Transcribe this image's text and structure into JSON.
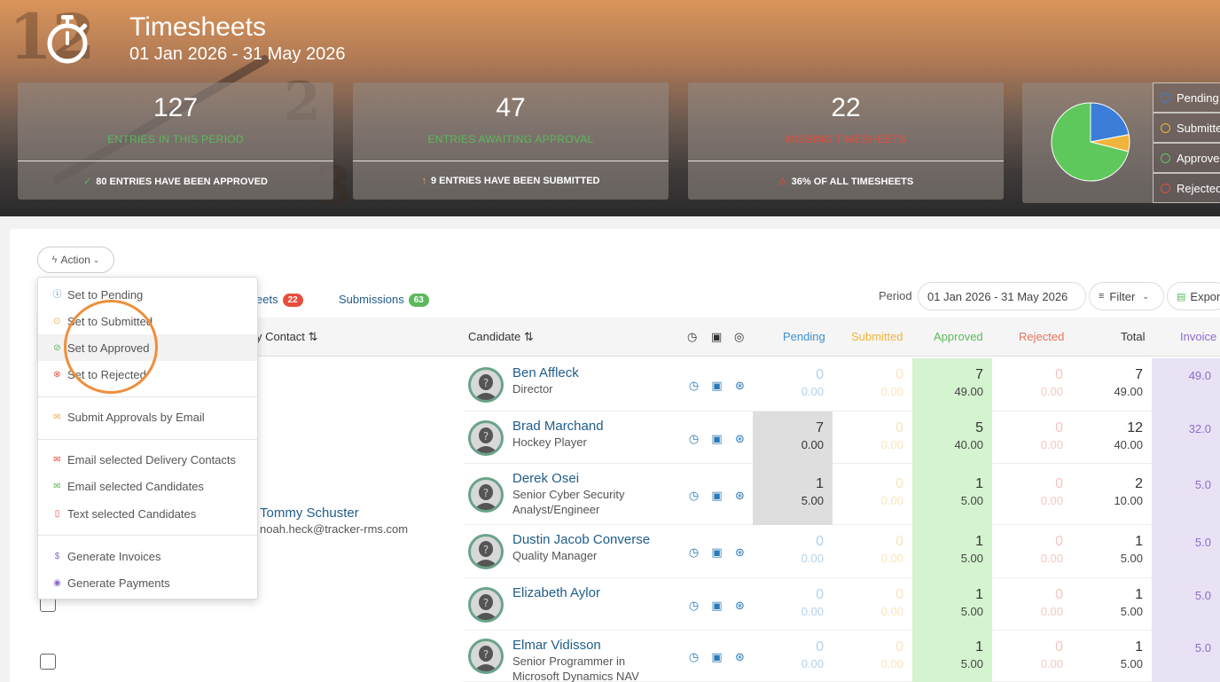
{
  "header": {
    "title": "Timesheets",
    "period": "01 Jan 2026 - 31 May 2026"
  },
  "stats": [
    {
      "value": "127",
      "label": "ENTRIES IN THIS PERIOD",
      "sub": "80 ENTRIES HAVE BEEN APPROVED",
      "sub_icon": "✓",
      "label_color": "#5cb85c",
      "icon_color": "#5cb85c"
    },
    {
      "value": "47",
      "label": "ENTRIES AWAITING APPROVAL",
      "sub": "9 ENTRIES HAVE BEEN SUBMITTED",
      "sub_icon": "↑",
      "label_color": "#5cb85c",
      "icon_color": "#f0ad4e"
    },
    {
      "value": "22",
      "label": "MISSING TIMESHEETS",
      "sub": "36% OF ALL TIMESHEETS",
      "sub_icon": "⚠",
      "label_color": "#e84c3d",
      "icon_color": "#e84c3d"
    }
  ],
  "pie": {
    "slices": [
      {
        "name": "Pending",
        "value": 22,
        "color": "#3b7dd8"
      },
      {
        "name": "Submitted",
        "value": 7,
        "color": "#f0b43c"
      },
      {
        "name": "Approved",
        "value": 71,
        "color": "#5ec85c"
      },
      {
        "name": "Rejected",
        "value": 0,
        "color": "#e84c3d"
      }
    ]
  },
  "legend": [
    {
      "label": "Pending",
      "color": "#3b7dd8"
    },
    {
      "label": "Submitted",
      "color": "#f0b43c"
    },
    {
      "label": "Approved",
      "color": "#5ec85c"
    },
    {
      "label": "Rejected",
      "color": "#e84c3d"
    }
  ],
  "toolbar": {
    "action_label": "Action",
    "tab_timesheets_label": "eets",
    "tab_timesheets_count": "22",
    "tab_submissions_label": "Submissions",
    "tab_submissions_count": "63",
    "period_label": "Period",
    "period_value": "01 Jan 2026 - 31 May 2026",
    "filter_label": "Filter",
    "export_label": "Expor"
  },
  "action_menu": {
    "items": [
      {
        "label": "Set to Pending",
        "icon": "help-circle-icon",
        "color": "#2b7bb9"
      },
      {
        "label": "Set to Submitted",
        "icon": "arrow-circle-icon",
        "color": "#f0ad4e"
      },
      {
        "label": "Set to Approved",
        "icon": "check-circle-icon",
        "color": "#5cb85c"
      },
      {
        "label": "Set to Rejected",
        "icon": "x-circle-icon",
        "color": "#e84c3d"
      },
      {
        "label": "Submit Approvals by Email",
        "icon": "envelope-icon",
        "color": "#f0ad4e"
      },
      {
        "label": "Email selected Delivery Contacts",
        "icon": "envelope-icon",
        "color": "#e84c3d"
      },
      {
        "label": "Email selected Candidates",
        "icon": "envelope-icon",
        "color": "#5cb85c"
      },
      {
        "label": "Text selected Candidates",
        "icon": "phone-icon",
        "color": "#e84c3d"
      },
      {
        "label": "Generate Invoices",
        "icon": "dollar-circle-icon",
        "color": "#8e6cc9"
      },
      {
        "label": "Generate Payments",
        "icon": "coins-icon",
        "color": "#8e6cc9"
      }
    ]
  },
  "table": {
    "headers": {
      "contact": "y Contact ⇅",
      "candidate": "Candidate ⇅",
      "pending": "Pending",
      "submitted": "Submitted",
      "approved": "Approved",
      "rejected": "Rejected",
      "total": "Total",
      "invoiced": "Invoice"
    },
    "contact": {
      "name": "Tommy Schuster",
      "email": "noah.heck@tracker-rms.com"
    },
    "rows": [
      {
        "name": "Ben Affleck",
        "title": "Director",
        "pending": [
          "0",
          "0.00"
        ],
        "submitted": [
          "0",
          "0.00"
        ],
        "approved": [
          "7",
          "49.00"
        ],
        "rejected": [
          "0",
          "0.00"
        ],
        "total": [
          "7",
          "49.00"
        ],
        "invoiced": [
          "",
          "49.0"
        ]
      },
      {
        "name": "Brad Marchand",
        "title": "Hockey Player",
        "pending": [
          "7",
          "0.00"
        ],
        "submitted": [
          "0",
          "0.00"
        ],
        "approved": [
          "5",
          "40.00"
        ],
        "rejected": [
          "0",
          "0.00"
        ],
        "total": [
          "12",
          "40.00"
        ],
        "invoiced": [
          "",
          "32.0"
        ]
      },
      {
        "name": "Derek Osei",
        "title": "Senior Cyber Security Analyst/Engineer",
        "pending": [
          "1",
          "5.00"
        ],
        "submitted": [
          "0",
          "0.00"
        ],
        "approved": [
          "1",
          "5.00"
        ],
        "rejected": [
          "0",
          "0.00"
        ],
        "total": [
          "2",
          "10.00"
        ],
        "invoiced": [
          "",
          "5.0"
        ]
      },
      {
        "name": "Dustin Jacob Converse",
        "title": "Quality Manager",
        "pending": [
          "0",
          "0.00"
        ],
        "submitted": [
          "0",
          "0.00"
        ],
        "approved": [
          "1",
          "5.00"
        ],
        "rejected": [
          "0",
          "0.00"
        ],
        "total": [
          "1",
          "5.00"
        ],
        "invoiced": [
          "",
          "5.0"
        ]
      },
      {
        "name": "Elizabeth Aylor",
        "title": "",
        "pending": [
          "0",
          "0.00"
        ],
        "submitted": [
          "0",
          "0.00"
        ],
        "approved": [
          "1",
          "5.00"
        ],
        "rejected": [
          "0",
          "0.00"
        ],
        "total": [
          "1",
          "5.00"
        ],
        "invoiced": [
          "",
          "5.0"
        ]
      },
      {
        "name": "Elmar Vidisson",
        "title": "Senior Programmer in Microsoft Dynamics NAV",
        "pending": [
          "0",
          "0.00"
        ],
        "submitted": [
          "0",
          "0.00"
        ],
        "approved": [
          "1",
          "5.00"
        ],
        "rejected": [
          "0",
          "0.00"
        ],
        "total": [
          "1",
          "5.00"
        ],
        "invoiced": [
          "",
          "5.0"
        ]
      }
    ]
  },
  "colors": {
    "pending": "#3b8fd0",
    "submitted": "#f0b43c",
    "approved": "#5cb85c",
    "rejected": "#e8735f",
    "invoiced": "#8e6cc9",
    "approved_bg": "#d4f3cf",
    "pending_hl_bg": "#dedede",
    "invoiced_bg": "#e8e2f4"
  }
}
